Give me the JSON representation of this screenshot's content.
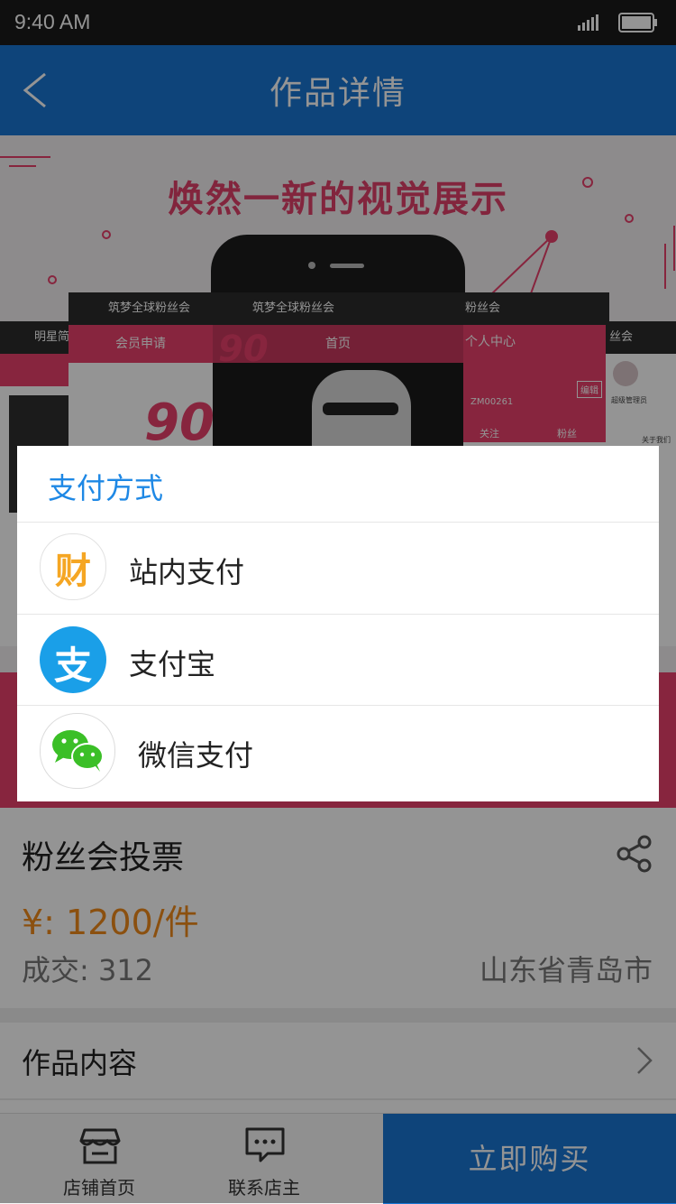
{
  "status_bar": {
    "time": "9:40 AM"
  },
  "nav": {
    "title": "作品详情",
    "back_icon": "chevron-left-icon"
  },
  "banner": {
    "headline": "焕然一新的视觉展示",
    "cards": [
      {
        "header": "明星简介"
      },
      {
        "header": "筑梦全球粉丝会",
        "pink": "会员申请"
      },
      {
        "header": "筑梦全球粉丝会",
        "pink": "首页"
      },
      {
        "header": "粉丝会",
        "pink": "个人中心",
        "badge": "编辑",
        "code": "ZM00261",
        "tab1": "关注",
        "tab2": "粉丝"
      },
      {
        "header": "丝会",
        "profile": "超级管理员",
        "menu1": "关于我们"
      }
    ],
    "logo_text": "90"
  },
  "payment_sheet": {
    "title": "支付方式",
    "options": [
      {
        "label": "站内支付",
        "icon": "wallet-icon",
        "icon_char": "财",
        "color": "#f5a623"
      },
      {
        "label": "支付宝",
        "icon": "alipay-icon",
        "icon_char": "支",
        "color": "#1a9fe8"
      },
      {
        "label": "微信支付",
        "icon": "wechat-icon",
        "color": "#3bbf27"
      }
    ]
  },
  "product": {
    "name": "粉丝会投票",
    "price": "¥: 1200/件",
    "sold": "成交: 312",
    "location": "山东省青岛市"
  },
  "content_row": {
    "label": "作品内容"
  },
  "tabbar": {
    "home_label": "店铺首页",
    "contact_label": "联系店主",
    "buy_label": "立即购买"
  },
  "colors": {
    "primary": "#1976d2",
    "accent_pink": "#e8416b",
    "price_orange": "#f08a1a"
  }
}
